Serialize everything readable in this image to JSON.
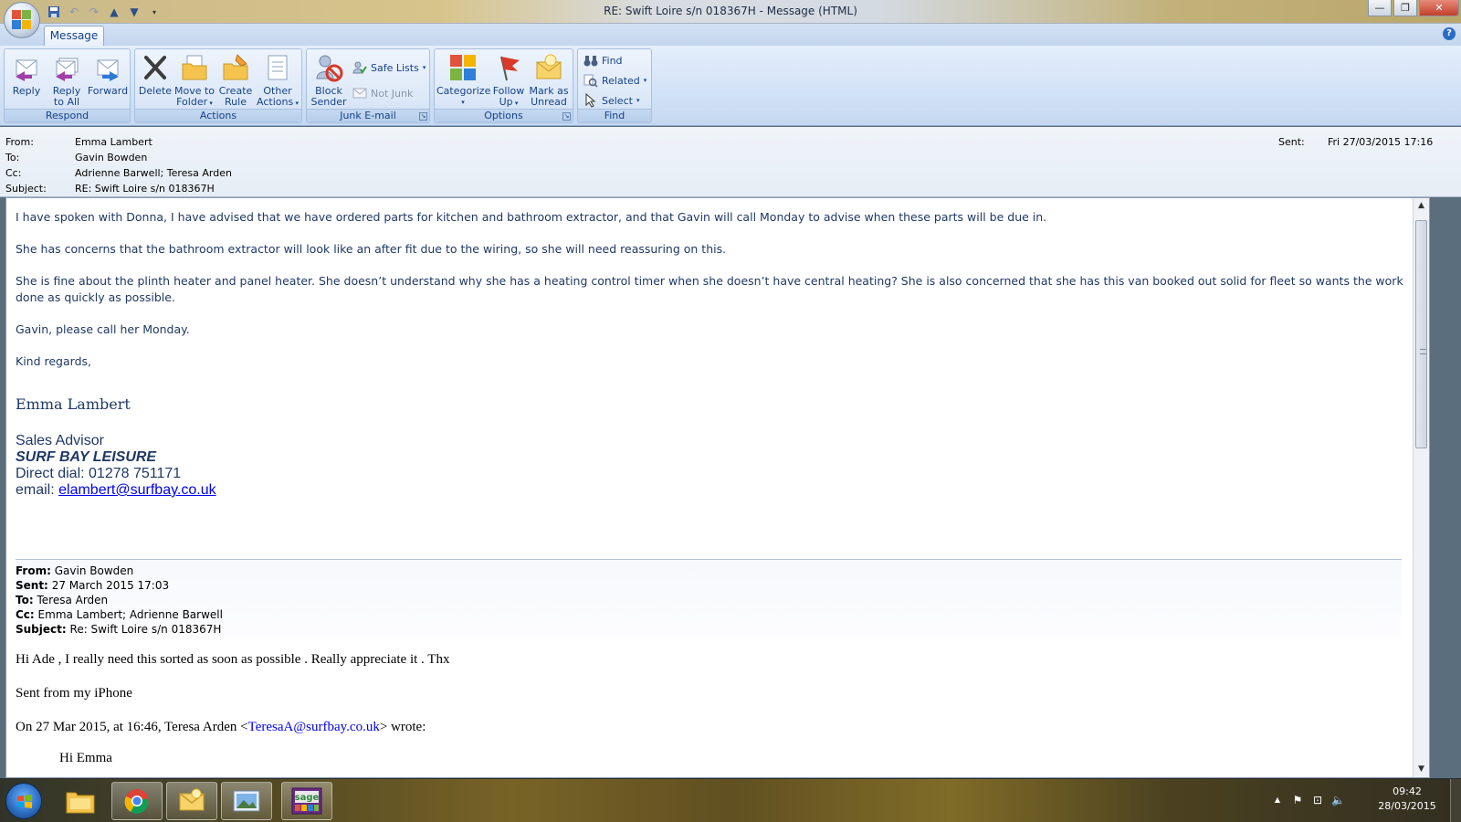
{
  "window": {
    "title": "RE: Swift Loire s/n 018367H - Message (HTML)"
  },
  "ribbon": {
    "tab": "Message",
    "groups": {
      "respond": {
        "label": "Respond",
        "reply": "Reply",
        "reply_all_1": "Reply",
        "reply_all_2": "to All",
        "forward": "Forward"
      },
      "actions": {
        "label": "Actions",
        "delete": "Delete",
        "move_1": "Move to",
        "move_2": "Folder",
        "rule_1": "Create",
        "rule_2": "Rule",
        "other_1": "Other",
        "other_2": "Actions"
      },
      "junk": {
        "label": "Junk E-mail",
        "block_1": "Block",
        "block_2": "Sender",
        "safe_lists": "Safe Lists",
        "not_junk": "Not Junk"
      },
      "options": {
        "label": "Options",
        "categorize": "Categorize",
        "follow_1": "Follow",
        "follow_2": "Up",
        "mark_1": "Mark as",
        "mark_2": "Unread"
      },
      "find": {
        "label": "Find",
        "find": "Find",
        "related": "Related",
        "select": "Select"
      }
    }
  },
  "header": {
    "from_label": "From:",
    "from": "Emma Lambert",
    "to_label": "To:",
    "to": "Gavin Bowden",
    "cc_label": "Cc:",
    "cc": "Adrienne Barwell; Teresa Arden",
    "subject_label": "Subject:",
    "subject": "RE: Swift Loire s/n 018367H",
    "sent_label": "Sent:",
    "sent": "Fri 27/03/2015 17:16"
  },
  "body": {
    "p1": "I have spoken with Donna, I have advised that we have ordered parts for kitchen and bathroom extractor, and that Gavin will call Monday to advise when these parts will be due in.",
    "p2": "She has concerns that the bathroom extractor will look like an after fit due to the wiring, so she will need reassuring on this.",
    "p3": "She is fine about the plinth heater and panel heater. She doesn’t understand why she has a heating control timer when she doesn’t have central heating? She is also concerned that she has this van booked out solid for fleet so wants the work done as quickly as possible.",
    "p4": "Gavin, please call her Monday.",
    "p5": "Kind regards,",
    "signature": {
      "name": "Emma Lambert",
      "title": "Sales Advisor",
      "company": "SURF BAY LEISURE",
      "direct_dial": "Direct dial: 01278 751171",
      "email_label": "email: ",
      "email": "elambert@surfbay.co.uk"
    }
  },
  "quoted": {
    "from_label": "From:",
    "from": "Gavin Bowden",
    "sent_label": "Sent:",
    "sent": "27 March 2015 17:03",
    "to_label": "To:",
    "to": "Teresa Arden",
    "cc_label": "Cc:",
    "cc": "Emma Lambert; Adrienne Barwell",
    "subject_label": "Subject:",
    "subject": "Re: Swift Loire s/n 018367H",
    "line1": "Hi Ade , I really need this sorted as soon as possible . Really appreciate it . Thx",
    "line2": "Sent from my iPhone",
    "wrote_prefix": "On 27 Mar 2015, at 16:46, Teresa Arden <",
    "wrote_email": "TeresaA@surfbay.co.uk",
    "wrote_suffix": "> wrote:",
    "greeting": "Hi Emma"
  },
  "taskbar": {
    "apps": [
      "file-explorer",
      "chrome",
      "outlook",
      "photo-viewer",
      "sage"
    ],
    "clock_time": "09:42",
    "clock_date": "28/03/2015"
  }
}
